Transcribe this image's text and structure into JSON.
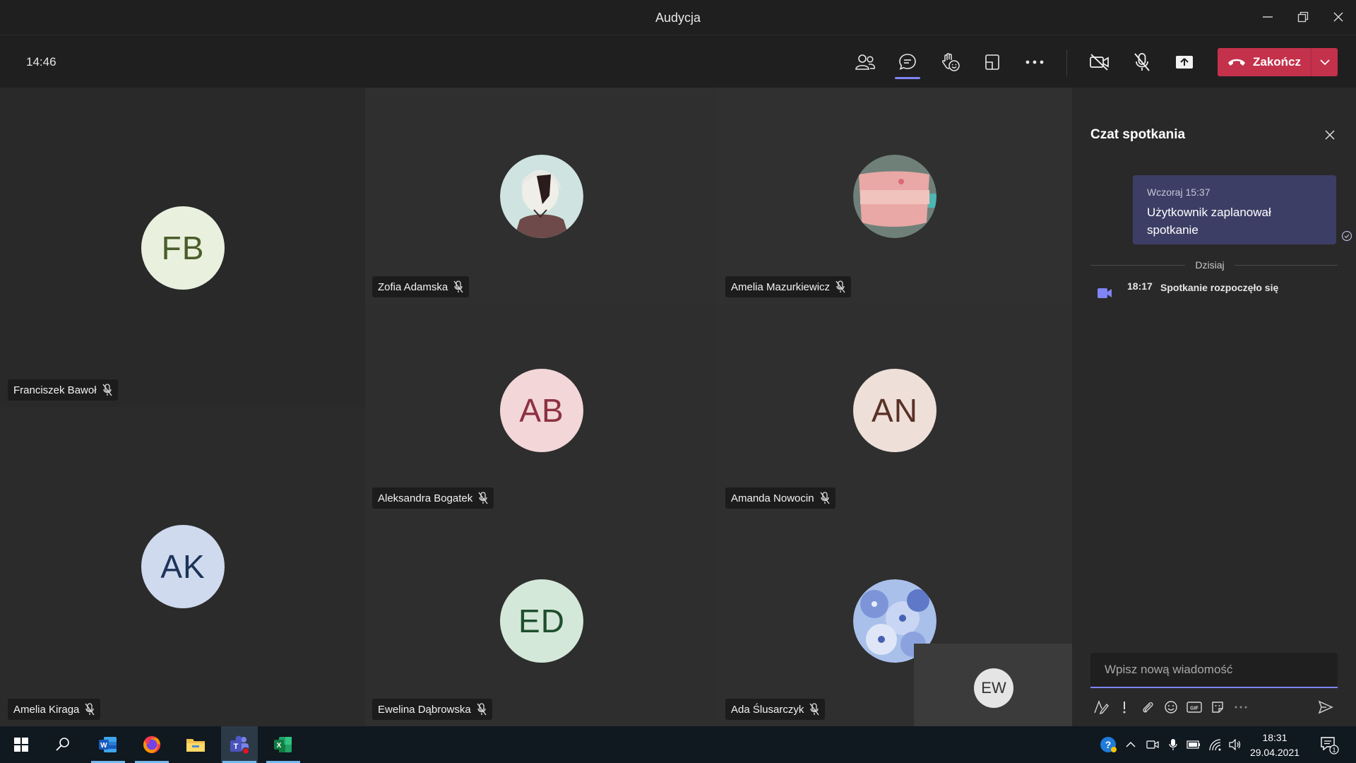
{
  "window": {
    "title": "Audycja"
  },
  "toolbar": {
    "timer": "14:46",
    "buttons": [
      {
        "name": "participants-icon"
      },
      {
        "name": "chat-icon",
        "active": true
      },
      {
        "name": "reactions-icon"
      },
      {
        "name": "room-view-icon"
      },
      {
        "name": "more-options-icon"
      }
    ],
    "hangup_label": "Zakończ",
    "accent": "#7f85f5",
    "hangup_color": "#c4314b"
  },
  "participants": [
    {
      "name": "Franciszek Bawoł",
      "initials": "FB",
      "avatar_bg": "#e9f1de",
      "avatar_fg": "#4b5d2a",
      "muted": true
    },
    {
      "name": "Zofia Adamska",
      "initials": "",
      "avatar_kind": "photo-anime",
      "muted": true
    },
    {
      "name": "Amelia Mazurkiewicz",
      "initials": "",
      "avatar_kind": "photo-pillow",
      "muted": true
    },
    {
      "name": "Aleksandra Bogatek",
      "initials": "AB",
      "avatar_bg": "#f3d6d8",
      "avatar_fg": "#8c3142",
      "muted": true
    },
    {
      "name": "Amanda Nowocin",
      "initials": "AN",
      "avatar_bg": "#eedfd9",
      "avatar_fg": "#5a3126",
      "muted": true
    },
    {
      "name": "Amelia Kiraga",
      "initials": "AK",
      "avatar_bg": "#cfdaef",
      "avatar_fg": "#1d3459",
      "muted": true
    },
    {
      "name": "Ewelina Dąbrowska",
      "initials": "ED",
      "avatar_bg": "#d4e8da",
      "avatar_fg": "#1f4f2e",
      "muted": true
    },
    {
      "name": "Ada Ślusarczyk",
      "initials": "",
      "avatar_kind": "photo-flowers",
      "muted": true
    }
  ],
  "self_view": {
    "initials": "EW"
  },
  "chat": {
    "title": "Czat spotkania",
    "message": {
      "time": "Wczoraj 15:37",
      "text": "Użytkownik zaplanował spotkanie"
    },
    "divider": "Dzisiaj",
    "event": {
      "time": "18:17",
      "text": "Spotkanie rozpoczęło się"
    },
    "compose_placeholder": "Wpisz nową wiadomość",
    "format_buttons": [
      "format-icon",
      "important-icon",
      "attach-icon",
      "emoji-icon",
      "gif-icon",
      "sticker-icon",
      "more-icon"
    ]
  },
  "taskbar": {
    "apps": [
      "windows-start-icon",
      "search-icon",
      "word-icon",
      "firefox-icon",
      "file-explorer-icon",
      "teams-icon",
      "excel-icon"
    ],
    "clock_time": "18:31",
    "clock_date": "29.04.2021",
    "notification_count": "1"
  }
}
